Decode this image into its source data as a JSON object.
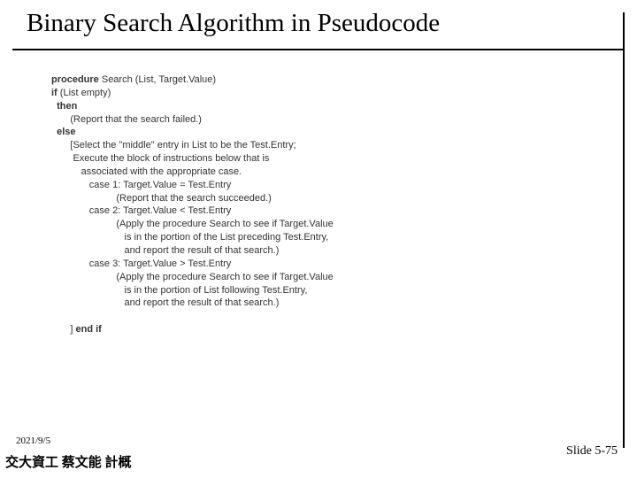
{
  "title": "Binary Search Algorithm in Pseudocode",
  "pseudo": {
    "l01a": "procedure",
    "l01b": " Search (List, Target.Value)",
    "l02a": "if",
    "l02b": " (List empty)",
    "l03": "  then",
    "l04": "       (Report that the search failed.)",
    "l05": "  else",
    "l06": "       [Select the \"middle\" entry in List to be the Test.Entry;",
    "l07": "        Execute the block of instructions below that is",
    "l08": "           associated with the appropriate case.",
    "l09": "              case 1: Target.Value = Test.Entry",
    "l10": "                        (Report that the search succeeded.)",
    "l11": "              case 2: Target.Value < Test.Entry",
    "l12": "                        (Apply the procedure Search to see if Target.Value",
    "l13": "                           is in the portion of the List preceding Test.Entry,",
    "l14": "                           and report the result of that search.)",
    "l15": "              case 3: Target.Value > Test.Entry",
    "l16": "                        (Apply the procedure Search to see if Target.Value",
    "l17": "                           is in the portion of List following Test.Entry,",
    "l18": "                           and report the result of that search.)",
    "l19": "",
    "l20a": "       ] ",
    "l20b": "end if"
  },
  "footer": {
    "date": "2021/9/5",
    "author": "交大資工 蔡文能 計概",
    "slide": "Slide 5-75"
  }
}
